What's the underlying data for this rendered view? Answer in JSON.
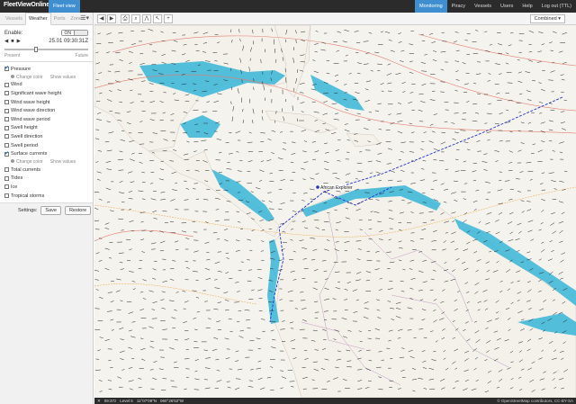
{
  "app": {
    "logo": "FleetView",
    "logo_suffix": "Online",
    "product_tab": "Fleet view"
  },
  "nav": [
    {
      "label": "Monitoring",
      "active": true
    },
    {
      "label": "Piracy",
      "active": false
    },
    {
      "label": "Vessels",
      "active": false
    },
    {
      "label": "Users",
      "active": false
    },
    {
      "label": "Help",
      "active": false
    },
    {
      "label": "Log out (TTL)",
      "active": false
    }
  ],
  "sidebar": {
    "tabs": [
      "Vessels",
      "Weather",
      "Ports",
      "Zones"
    ],
    "active_tab": "Weather",
    "enable_label": "Enable:",
    "enable_state": "ON",
    "datetime": "25.01 09:30:31Z",
    "present_label": "Present",
    "future_label": "Future",
    "slider_fraction": 0.38,
    "layers": [
      {
        "label": "Pressure",
        "checked": true,
        "options": [
          "Change color",
          "Show values"
        ]
      },
      {
        "label": "Wind",
        "checked": false
      },
      {
        "label": "Significant wave height",
        "checked": false
      },
      {
        "label": "Wind wave height",
        "checked": false
      },
      {
        "label": "Wind wave direction",
        "checked": false
      },
      {
        "label": "Wind wave period",
        "checked": false
      },
      {
        "label": "Swell height",
        "checked": false
      },
      {
        "label": "Swell direction",
        "checked": false
      },
      {
        "label": "Swell period",
        "checked": false
      },
      {
        "label": "Surface currents",
        "checked": true,
        "options": [
          "Change color",
          "Show values"
        ]
      },
      {
        "label": "Total currents",
        "checked": false
      },
      {
        "label": "Tides",
        "checked": false
      },
      {
        "label": "Ice",
        "checked": false
      },
      {
        "label": "Tropical storms",
        "checked": false
      }
    ],
    "settings_label": "Settings:",
    "save_label": "Save",
    "restore_label": "Restore"
  },
  "toolbar": {
    "layer_select": "Combined"
  },
  "map": {
    "vessel_name": "African Explorer"
  },
  "status": {
    "time": "09:37z",
    "level": "Level 5",
    "lat": "11°07'09\"N",
    "lon": "060°26'52\"W",
    "attribution": "© OpenStreetMap contributors, CC-BY-SA"
  },
  "colors": {
    "sea": "#ffffff",
    "shallow": "#38b6d8",
    "land": "#f3f1ea",
    "accent": "#3f8fd0",
    "isobar": "#e67b6d",
    "route": "#2233cc",
    "eez": "#f0a640"
  }
}
